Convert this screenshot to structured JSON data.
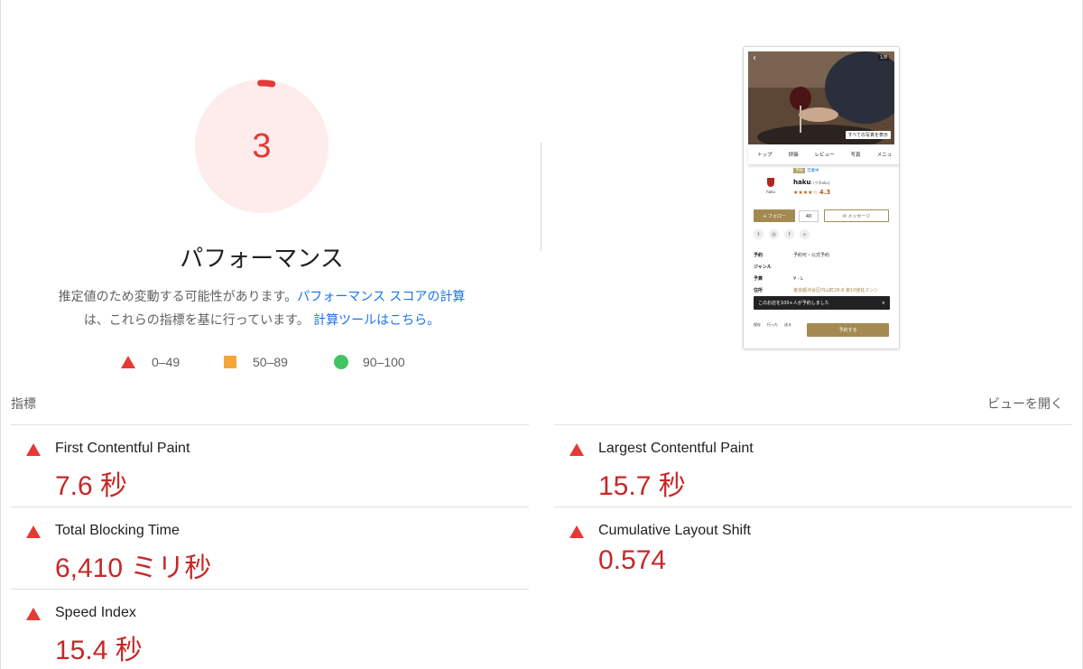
{
  "score": {
    "value": "3",
    "fraction": 0.03,
    "color": "#e53935",
    "track_color": "#fdeceb"
  },
  "category_title": "パフォーマンス",
  "description": {
    "line1": "推定値のため変動する可能性があります。",
    "link1": "パフォーマンス スコアの計算",
    "line2": "は、これらの指標を基に行っています。",
    "link2": "計算ツールはこちら。"
  },
  "legend": [
    {
      "range": "0–49",
      "icon": "triangle-fail-icon",
      "color": "#e53935"
    },
    {
      "range": "50–89",
      "icon": "square-average-icon",
      "color": "#f4a639"
    },
    {
      "range": "90–100",
      "icon": "circle-pass-icon",
      "color": "#43c463"
    }
  ],
  "screenshot": {
    "back": "‹",
    "photo_count": "1/8",
    "all_photos": "すべての写真を表示",
    "tabs": [
      "トップ",
      "評価",
      "レビュー",
      "写真",
      "メニュ"
    ],
    "logo_text": "haku",
    "badge1": "予約",
    "badge2": "営業中",
    "name": "haku",
    "name_sub": "ハク(haku)",
    "stars": "★★★★☆",
    "rating": "4.3",
    "follow": "+ フォロー",
    "follow_count": "40",
    "message": "✉ メッセージ",
    "social": [
      "t",
      "◎",
      "f",
      "∞"
    ],
    "info": [
      {
        "k": "予約",
        "v": "予約可・公式予約"
      },
      {
        "k": "ジャンル",
        "v": ""
      },
      {
        "k": "予算",
        "v": "¥ - L"
      },
      {
        "k": "住所",
        "v": "東京都渋谷区円山町28-8 第10宮廷マンシ"
      }
    ],
    "toast": "このお店を100+人が予約しました",
    "toast_close": "×",
    "footer": [
      "保存",
      "行った",
      "送る"
    ],
    "reserve": "予約する"
  },
  "metrics_title": "指標",
  "view_toggle": "ビューを開く",
  "metrics": {
    "fcp": {
      "title": "First Contentful Paint",
      "value": "7.6 秒"
    },
    "lcp": {
      "title": "Largest Contentful Paint",
      "value": "15.7 秒"
    },
    "tbt": {
      "title": "Total Blocking Time",
      "value": "6,410 ミリ秒"
    },
    "cls": {
      "title": "Cumulative Layout Shift",
      "value": "0.574"
    },
    "si": {
      "title": "Speed Index",
      "value": "15.4 秒"
    }
  },
  "colors": {
    "fail": "#e53935",
    "value": "#c62828",
    "link": "#1a73e8",
    "gold": "#a48a52"
  }
}
